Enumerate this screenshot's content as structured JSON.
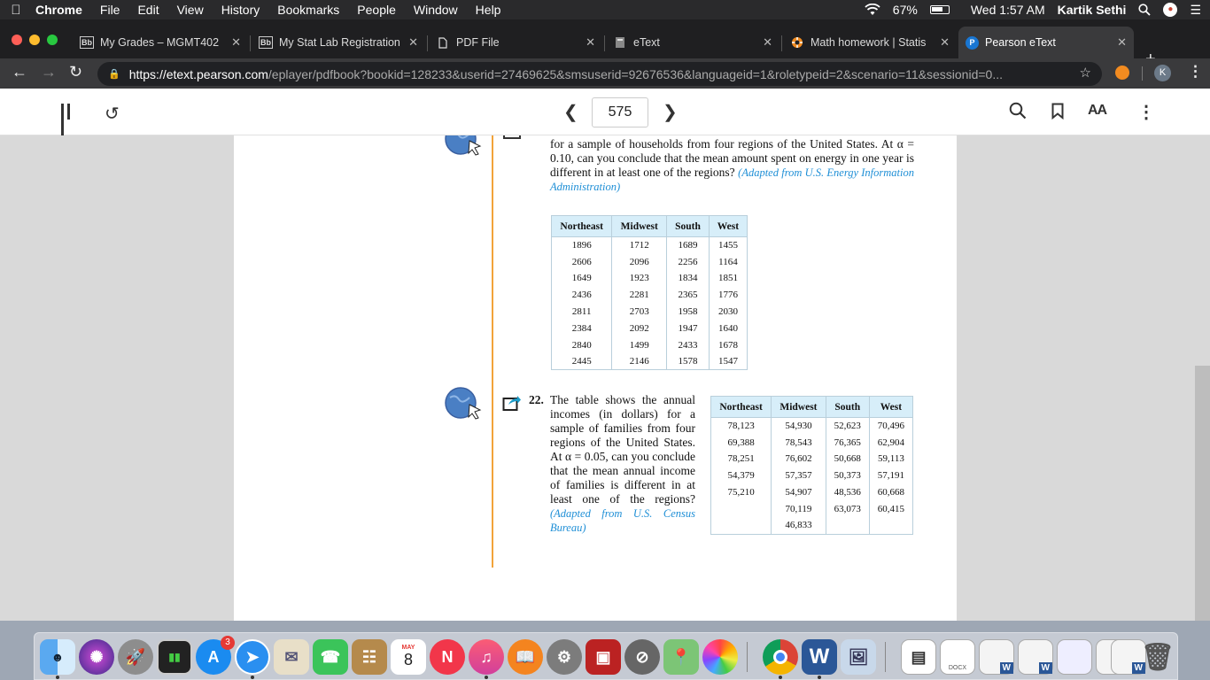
{
  "menubar": {
    "app": "Chrome",
    "items": [
      "File",
      "Edit",
      "View",
      "History",
      "Bookmarks",
      "People",
      "Window",
      "Help"
    ],
    "battery": "67%",
    "clock": "Wed 1:57 AM",
    "user": "Kartik Sethi"
  },
  "tabs": [
    {
      "title": "My Grades – MGMT402",
      "favicon": "Bb"
    },
    {
      "title": "My Stat Lab Registration",
      "favicon": "Bb"
    },
    {
      "title": "PDF File",
      "favicon": ""
    },
    {
      "title": "eText",
      "favicon": ""
    },
    {
      "title": "Math homework | Statis",
      "favicon": ""
    },
    {
      "title": "Pearson eText",
      "favicon": "P"
    }
  ],
  "address": {
    "host": "https://etext.pearson.com",
    "path": "/eplayer/pdfbook?bookid=128233&userid=27469625&smsuserid=92676536&languageid=1&roletypeid=2&scenario=11&sessionid=0..."
  },
  "profile_initial": "K",
  "toolbar": {
    "page_number": "575",
    "text_size_label": "AA"
  },
  "problem21": {
    "text": "for a sample of households from four regions of the United States. At α = 0.10, can you conclude that the mean amount spent on energy in one year is different in at least one of the regions?",
    "cite": "(Adapted from U.S. Energy Information Administration)",
    "headers": [
      "Northeast",
      "Midwest",
      "South",
      "West"
    ],
    "rows": [
      [
        "1896",
        "1712",
        "1689",
        "1455"
      ],
      [
        "2606",
        "2096",
        "2256",
        "1164"
      ],
      [
        "1649",
        "1923",
        "1834",
        "1851"
      ],
      [
        "2436",
        "2281",
        "2365",
        "1776"
      ],
      [
        "2811",
        "2703",
        "1958",
        "2030"
      ],
      [
        "2384",
        "2092",
        "1947",
        "1640"
      ],
      [
        "2840",
        "1499",
        "2433",
        "1678"
      ],
      [
        "2445",
        "2146",
        "1578",
        "1547"
      ]
    ]
  },
  "problem22": {
    "number": "22.",
    "text": "The table shows the annual incomes (in dollars) for a sample of families from four regions of the United States. At α = 0.05, can you conclude that the mean annual income of families is different in at least one of the regions?",
    "cite": "(Adapted from U.S. Census Bureau)",
    "headers": [
      "Northeast",
      "Midwest",
      "South",
      "West"
    ],
    "rows": [
      [
        "78,123",
        "54,930",
        "52,623",
        "70,496"
      ],
      [
        "69,388",
        "78,543",
        "76,365",
        "62,904"
      ],
      [
        "78,251",
        "76,602",
        "50,668",
        "59,113"
      ],
      [
        "54,379",
        "57,357",
        "50,373",
        "57,191"
      ],
      [
        "75,210",
        "54,907",
        "48,536",
        "60,668"
      ],
      [
        "",
        "70,119",
        "63,073",
        "60,415"
      ],
      [
        "",
        "46,833",
        "",
        ""
      ]
    ]
  },
  "dock": {
    "appstore_badge": "3",
    "calendar_month": "MAY",
    "calendar_day": "8",
    "word_label": "W",
    "doc_label": "DOCX"
  }
}
